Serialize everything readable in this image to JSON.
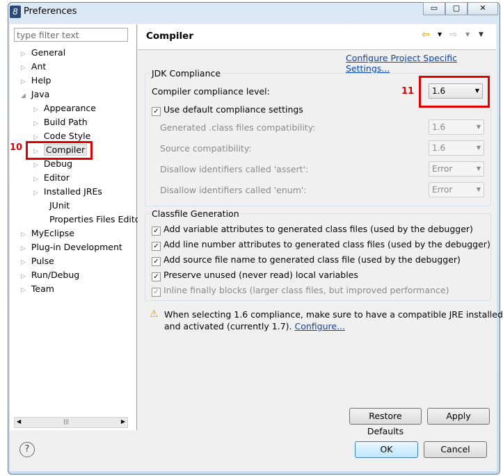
{
  "window": {
    "title": "Preferences",
    "minimize": "▭",
    "maximize": "▢",
    "close": "✕"
  },
  "filter": {
    "placeholder": "type filter text"
  },
  "tree": [
    {
      "label": "General",
      "level": 0,
      "arrow": true
    },
    {
      "label": "Ant",
      "level": 0,
      "arrow": true
    },
    {
      "label": "Help",
      "level": 0,
      "arrow": true
    },
    {
      "label": "Java",
      "level": 0,
      "arrow": true,
      "expanded": true
    },
    {
      "label": "Appearance",
      "level": 1,
      "arrow": true
    },
    {
      "label": "Build Path",
      "level": 1,
      "arrow": true
    },
    {
      "label": "Code Style",
      "level": 1,
      "arrow": true
    },
    {
      "label": "Compiler",
      "level": 1,
      "arrow": true,
      "selected": true
    },
    {
      "label": "Debug",
      "level": 1,
      "arrow": true
    },
    {
      "label": "Editor",
      "level": 1,
      "arrow": true
    },
    {
      "label": "Installed JREs",
      "level": 1,
      "arrow": true
    },
    {
      "label": "JUnit",
      "level": 1,
      "arrow": false
    },
    {
      "label": "Properties Files Edito",
      "level": 1,
      "arrow": false
    },
    {
      "label": "MyEclipse",
      "level": 0,
      "arrow": true
    },
    {
      "label": "Plug-in Development",
      "level": 0,
      "arrow": true
    },
    {
      "label": "Pulse",
      "level": 0,
      "arrow": true
    },
    {
      "label": "Run/Debug",
      "level": 0,
      "arrow": true
    },
    {
      "label": "Team",
      "level": 0,
      "arrow": true
    }
  ],
  "annotations": {
    "n10": "10",
    "n11": "11"
  },
  "page": {
    "title": "Compiler",
    "configure_link": "Configure Project Specific Settings..."
  },
  "jdk": {
    "group": "JDK Compliance",
    "level_label": "Compiler compliance level:",
    "level_value": "1.6",
    "use_default": "Use default compliance settings",
    "rows": [
      {
        "label": "Generated .class files compatibility:",
        "value": "1.6"
      },
      {
        "label": "Source compatibility:",
        "value": "1.6"
      },
      {
        "label": "Disallow identifiers called 'assert':",
        "value": "Error"
      },
      {
        "label": "Disallow identifiers called 'enum':",
        "value": "Error"
      }
    ]
  },
  "classfile": {
    "group": "Classfile Generation",
    "items": [
      {
        "label": "Add variable attributes to generated class files (used by the debugger)",
        "checked": true,
        "enabled": true
      },
      {
        "label": "Add line number attributes to generated class files (used by the debugger)",
        "checked": true,
        "enabled": true
      },
      {
        "label": "Add source file name to generated class file (used by the debugger)",
        "checked": true,
        "enabled": true
      },
      {
        "label": "Preserve unused (never read) local variables",
        "checked": true,
        "enabled": true
      },
      {
        "label": "Inline finally blocks (larger class files, but improved performance)",
        "checked": true,
        "enabled": false
      }
    ]
  },
  "warning": {
    "line1": "When selecting 1.6 compliance, make sure to have a compatible JRE installed",
    "line2": "and activated (currently 1.7). ",
    "link": "Configure..."
  },
  "buttons": {
    "restore": "Restore Defaults",
    "apply": "Apply",
    "ok": "OK",
    "cancel": "Cancel",
    "help": "?"
  }
}
